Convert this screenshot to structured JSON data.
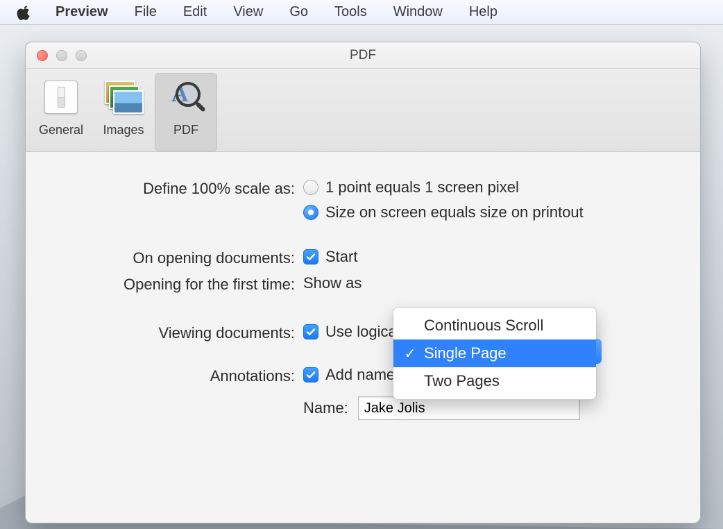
{
  "menubar": {
    "app": "Preview",
    "items": [
      "File",
      "Edit",
      "View",
      "Go",
      "Tools",
      "Window",
      "Help"
    ]
  },
  "window": {
    "title": "PDF"
  },
  "toolbar": {
    "general": "General",
    "images": "Images",
    "pdf": "PDF"
  },
  "prefs": {
    "scale_label": "Define 100% scale as:",
    "scale_opt1": "1 point equals 1 screen pixel",
    "scale_opt2": "Size on screen equals size on printout",
    "open_label": "On opening documents:",
    "open_check": "Start",
    "firsttime_label": "Opening for the first time:",
    "firsttime_prefix": "Show as",
    "viewing_label": "Viewing documents:",
    "viewing_check": "Use logical page numbers (e.g. \"iv\")",
    "annotations_label": "Annotations:",
    "annotations_check": "Add name to annotations",
    "name_label": "Name:",
    "name_value": "Jake Jolis"
  },
  "dropdown": {
    "opt1": "Continuous Scroll",
    "opt2": "Single Page",
    "opt3": "Two Pages"
  }
}
